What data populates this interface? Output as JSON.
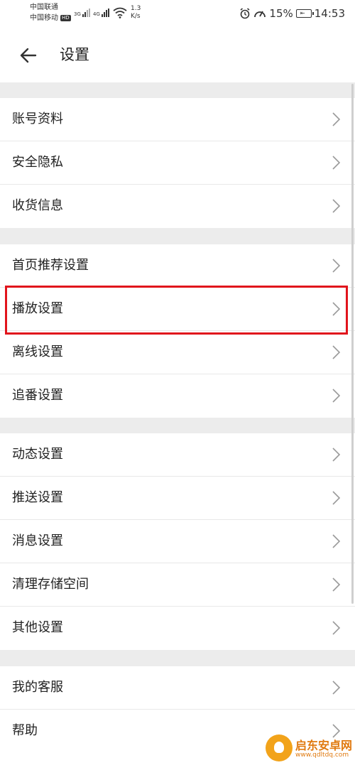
{
  "status_bar": {
    "carrier_1": "中国联通",
    "carrier_2": "中国移动",
    "hd": "HD",
    "net_1": "3G",
    "net_2": "4G",
    "speed_value": "1.3",
    "speed_unit": "K/s",
    "battery": "15%",
    "time": "14:53"
  },
  "header": {
    "title": "设置"
  },
  "groups": [
    {
      "items": [
        {
          "label": "账号资料"
        },
        {
          "label": "安全隐私"
        },
        {
          "label": "收货信息"
        }
      ]
    },
    {
      "items": [
        {
          "label": "首页推荐设置"
        },
        {
          "label": "播放设置"
        },
        {
          "label": "离线设置"
        },
        {
          "label": "追番设置"
        }
      ]
    },
    {
      "items": [
        {
          "label": "动态设置"
        },
        {
          "label": "推送设置"
        },
        {
          "label": "消息设置"
        },
        {
          "label": "清理存储空间"
        },
        {
          "label": "其他设置"
        }
      ]
    },
    {
      "items": [
        {
          "label": "我的客服"
        },
        {
          "label": "帮助"
        }
      ]
    }
  ],
  "watermark": {
    "name": "启东安卓网",
    "url": "www.qdltdq.com"
  },
  "colors": {
    "highlight": "#e1141c",
    "divider": "#e8e8e8",
    "background": "#ececec",
    "watermark": "#e07a10"
  }
}
